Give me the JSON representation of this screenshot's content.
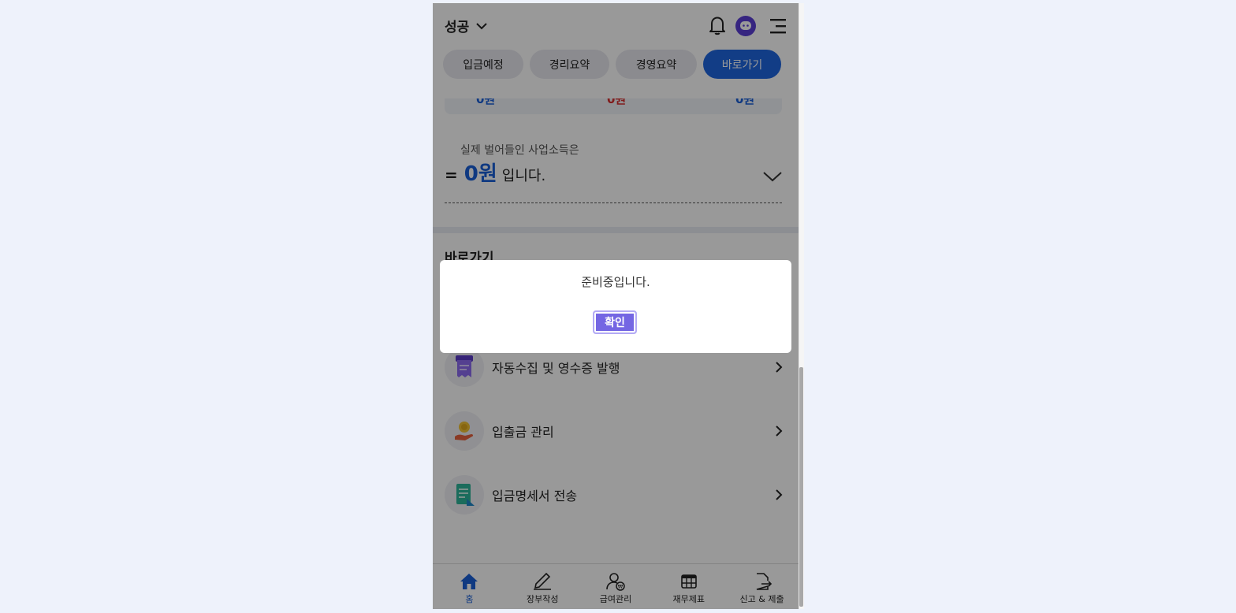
{
  "header": {
    "company_name": "성공"
  },
  "tabs": [
    {
      "label": "입금예정"
    },
    {
      "label": "경리요약"
    },
    {
      "label": "경영요약"
    },
    {
      "label": "바로가기",
      "active": true
    }
  ],
  "summary": {
    "strip_values": [
      "0원",
      "0원",
      "0원"
    ],
    "income_label": "실제 벌어들인 사업소득은",
    "equals": "=",
    "amount": "0원",
    "suffix": "입니다."
  },
  "shortcuts": {
    "title": "바로가기",
    "items": [
      {
        "label": "자동수집 및 영수증 발행",
        "icon": "receipt-icon"
      },
      {
        "label": "입출금 관리",
        "icon": "coin-hand-icon"
      },
      {
        "label": "입금명세서 전송",
        "icon": "document-send-icon"
      }
    ]
  },
  "bottom_nav": [
    {
      "label": "홈",
      "icon": "home-icon",
      "active": true
    },
    {
      "label": "장부작성",
      "icon": "pen-icon"
    },
    {
      "label": "급여관리",
      "icon": "payroll-icon"
    },
    {
      "label": "재무제표",
      "icon": "table-icon"
    },
    {
      "label": "신고 & 제출",
      "icon": "file-export-icon"
    }
  ],
  "dialog": {
    "message": "준비중입니다.",
    "confirm_label": "확인"
  },
  "colors": {
    "primary": "#1f66e0",
    "dialog_button": "#7466e3",
    "avatar": "#5b3fd6"
  }
}
